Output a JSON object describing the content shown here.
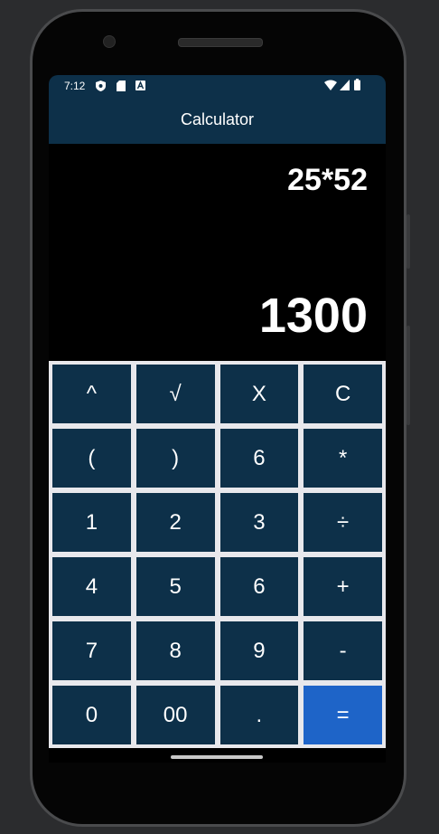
{
  "status_bar": {
    "time": "7:12"
  },
  "app_bar": {
    "title": "Calculator"
  },
  "display": {
    "expression": "25*52",
    "result": "1300"
  },
  "keypad": {
    "keys": [
      {
        "label": "^",
        "name": "power-key"
      },
      {
        "label": "√",
        "name": "sqrt-key"
      },
      {
        "label": "X",
        "name": "backspace-key"
      },
      {
        "label": "C",
        "name": "clear-key"
      },
      {
        "label": "(",
        "name": "open-paren-key"
      },
      {
        "label": ")",
        "name": "close-paren-key"
      },
      {
        "label": "6",
        "name": "digit-6-key-top"
      },
      {
        "label": "*",
        "name": "multiply-key"
      },
      {
        "label": "1",
        "name": "digit-1-key"
      },
      {
        "label": "2",
        "name": "digit-2-key"
      },
      {
        "label": "3",
        "name": "digit-3-key"
      },
      {
        "label": "÷",
        "name": "divide-key"
      },
      {
        "label": "4",
        "name": "digit-4-key"
      },
      {
        "label": "5",
        "name": "digit-5-key"
      },
      {
        "label": "6",
        "name": "digit-6-key"
      },
      {
        "label": "+",
        "name": "plus-key"
      },
      {
        "label": "7",
        "name": "digit-7-key"
      },
      {
        "label": "8",
        "name": "digit-8-key"
      },
      {
        "label": "9",
        "name": "digit-9-key"
      },
      {
        "label": "-",
        "name": "minus-key"
      },
      {
        "label": "0",
        "name": "digit-0-key"
      },
      {
        "label": "00",
        "name": "double-zero-key"
      },
      {
        "label": ".",
        "name": "decimal-key"
      },
      {
        "label": "=",
        "name": "equals-key",
        "accent": true
      }
    ]
  },
  "icons": {
    "status_left": [
      "shield-icon",
      "sd-card-icon",
      "a-icon"
    ],
    "status_right": [
      "wifi-icon",
      "signal-icon",
      "battery-icon"
    ]
  },
  "colors": {
    "primary": "#0d3049",
    "accent": "#1e64c8",
    "keypad_background": "#e8e8ec"
  }
}
